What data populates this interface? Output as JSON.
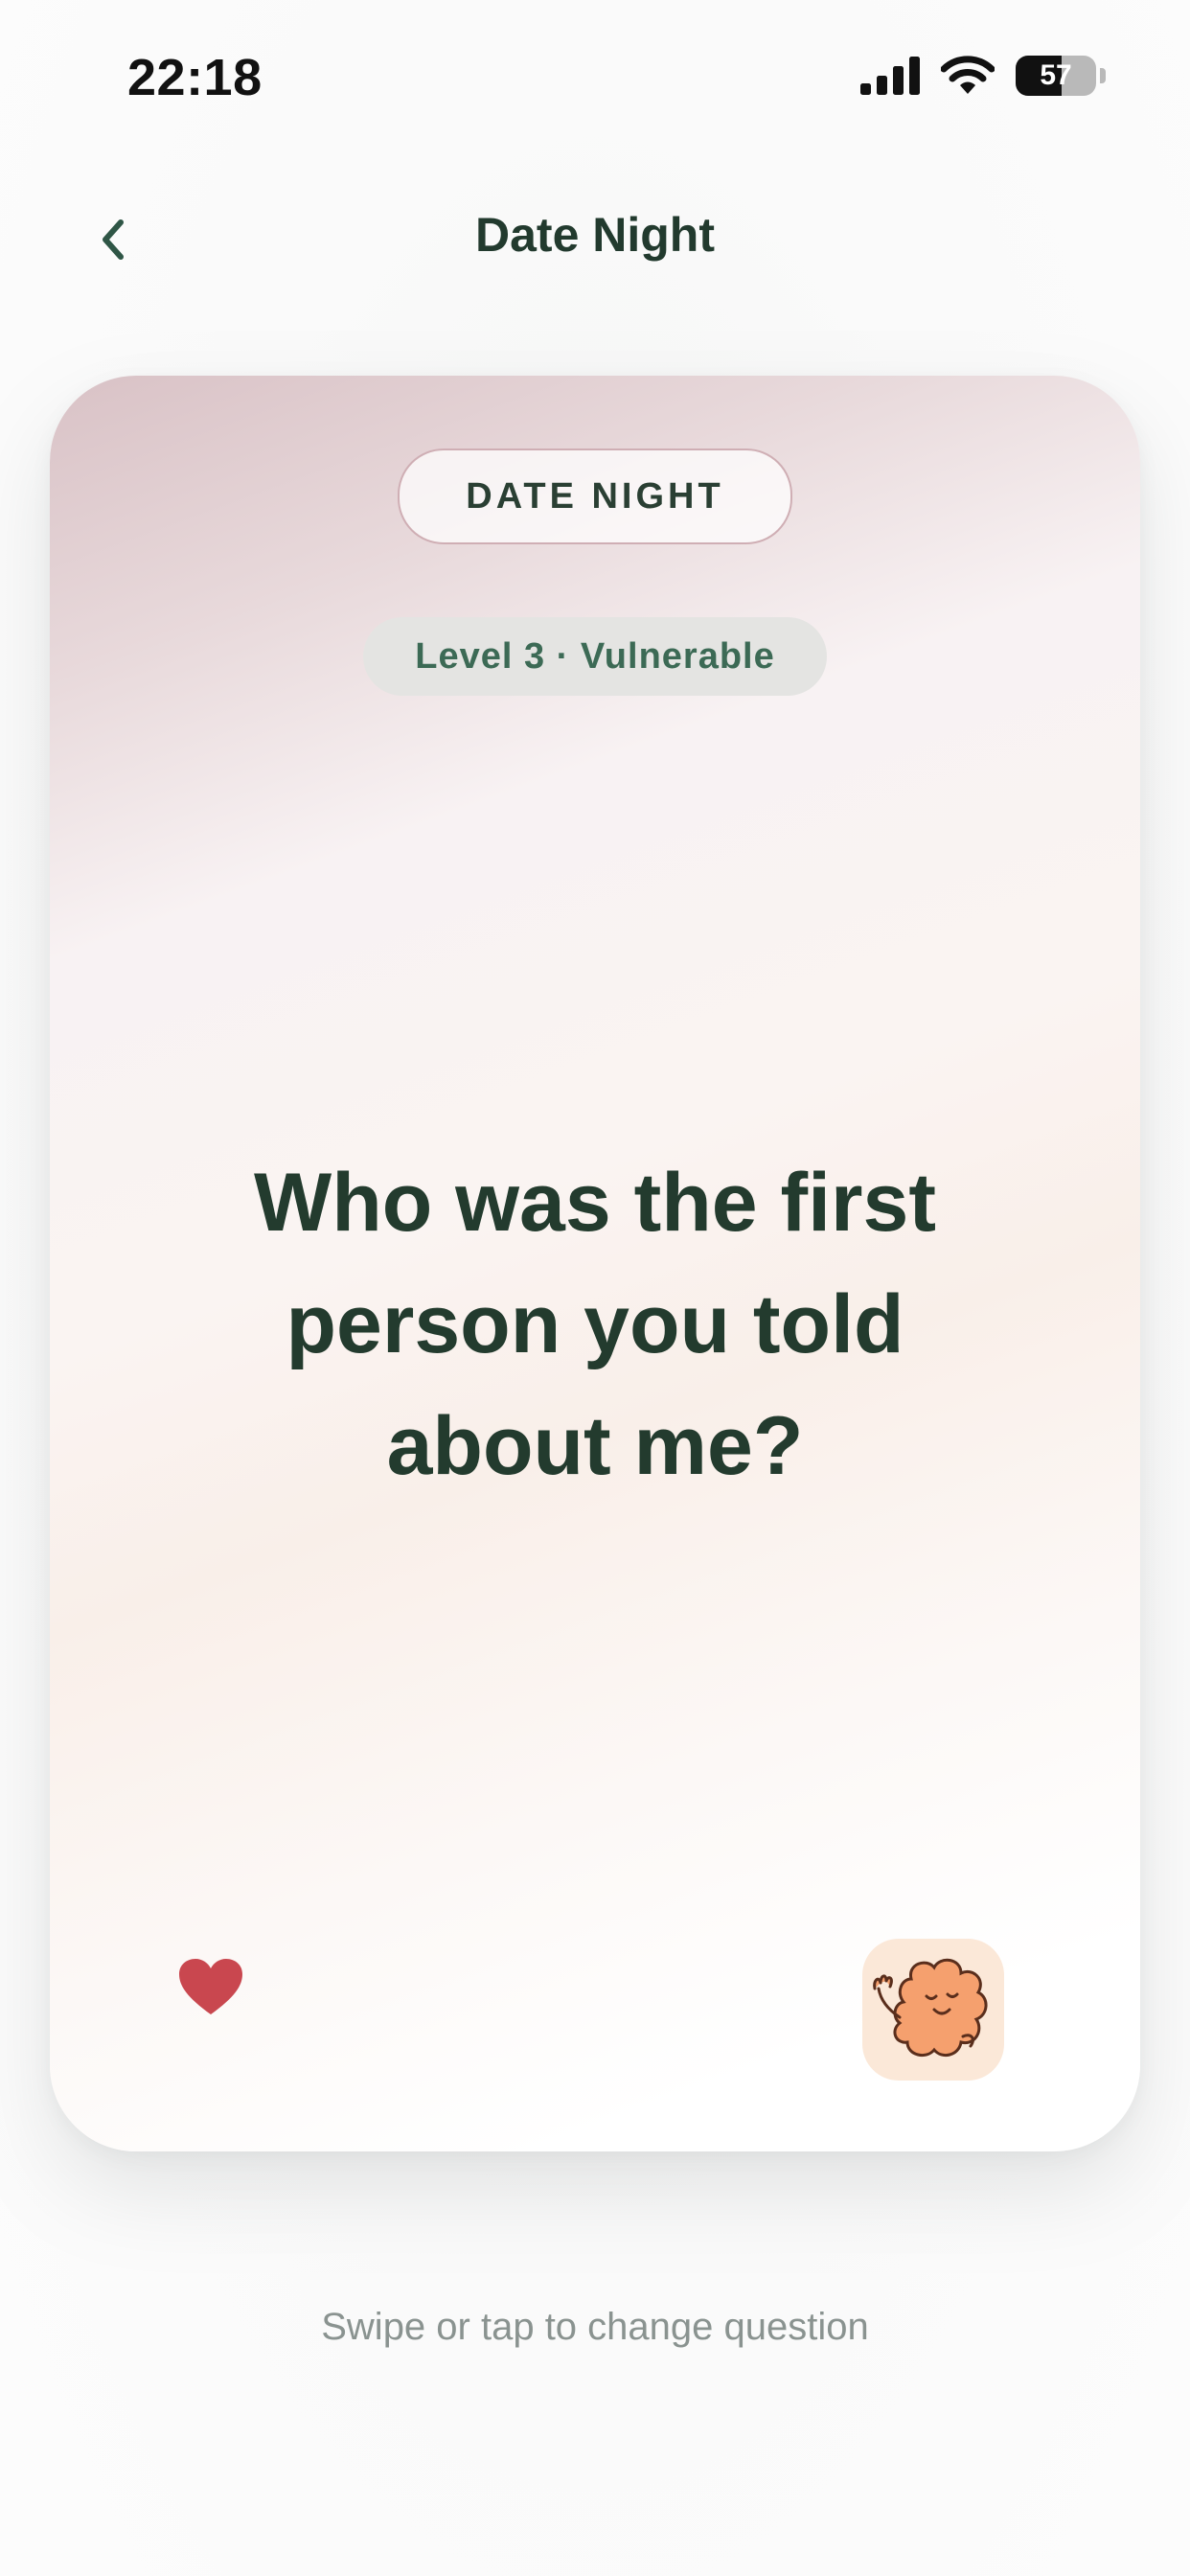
{
  "status_bar": {
    "time": "22:18",
    "battery": "57"
  },
  "nav": {
    "title": "Date Night"
  },
  "card": {
    "deck_label": "DATE NIGHT",
    "level_label": "Level 3 · Vulnerable",
    "question": "Who was the first person you told about me?"
  },
  "footer": {
    "hint": "Swipe or tap to change question"
  },
  "colors": {
    "heading_green": "#233b2e",
    "level_green": "#3c6a55",
    "heart_red": "#c9474f",
    "mascot_orange": "#f5a06e",
    "mascot_bg": "#fbe8d8"
  },
  "icons": [
    "cellular-signal-icon",
    "wifi-icon",
    "battery-icon",
    "chevron-left-icon",
    "heart-icon",
    "mascot-icon"
  ]
}
